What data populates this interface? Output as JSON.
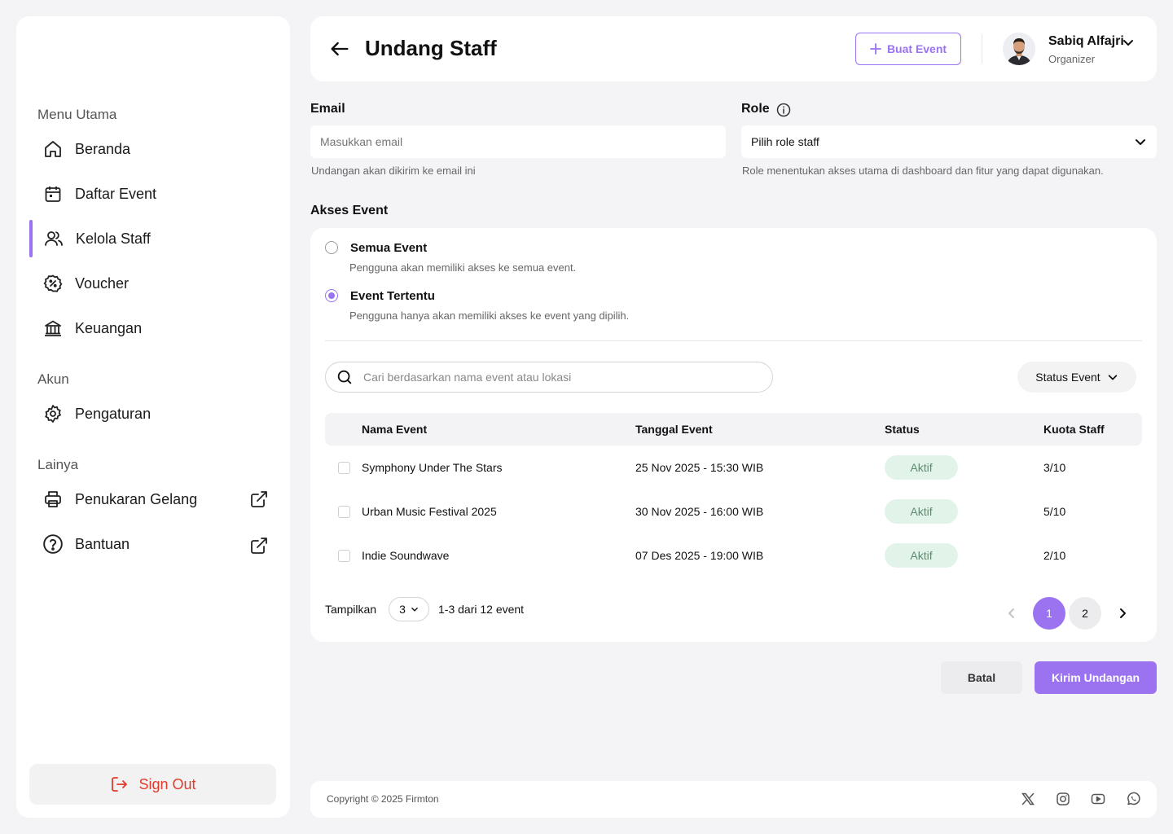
{
  "sidebar": {
    "sections": {
      "main": "Menu Utama",
      "account": "Akun",
      "other": "Lainya"
    },
    "items": [
      {
        "label": "Beranda",
        "icon": "home-icon"
      },
      {
        "label": "Daftar Event",
        "icon": "calendar-icon"
      },
      {
        "label": "Kelola Staff",
        "icon": "users-icon",
        "active": true
      },
      {
        "label": "Voucher",
        "icon": "voucher-icon"
      },
      {
        "label": "Keuangan",
        "icon": "bank-icon"
      },
      {
        "label": "Pengaturan",
        "icon": "gear-icon"
      },
      {
        "label": "Penukaran Gelang",
        "icon": "printer-icon",
        "external": true
      },
      {
        "label": "Bantuan",
        "icon": "help-icon",
        "external": true
      }
    ],
    "signout": "Sign Out"
  },
  "header": {
    "title": "Undang Staff",
    "create_button": "Buat Event",
    "user": {
      "name": "Sabiq Alfajri",
      "role": "Organizer"
    }
  },
  "form": {
    "email": {
      "label": "Email",
      "placeholder": "Masukkan email",
      "help": "Undangan akan dikirim ke email ini"
    },
    "role": {
      "label": "Role",
      "value": "Pilih role staff",
      "help": "Role menentukan akses utama di dashboard dan fitur yang dapat digunakan."
    }
  },
  "access": {
    "title": "Akses Event",
    "options": [
      {
        "label": "Semua Event",
        "desc": "Pengguna akan memiliki akses ke semua event.",
        "selected": false
      },
      {
        "label": "Event Tertentu",
        "desc": "Pengguna hanya akan memiliki akses ke event yang dipilih.",
        "selected": true
      }
    ],
    "search_placeholder": "Cari berdasarkan nama event atau lokasi",
    "status_filter": "Status Event",
    "columns": [
      "Nama Event",
      "Tanggal Event",
      "Status",
      "Kuota Staff"
    ],
    "rows": [
      {
        "name": "Symphony Under The Stars",
        "date": "25 Nov 2025 - 15:30 WIB",
        "status": "Aktif",
        "quota": "3/10"
      },
      {
        "name": "Urban Music Festival 2025",
        "date": "30 Nov 2025 - 16:00 WIB",
        "status": "Aktif",
        "quota": "5/10"
      },
      {
        "name": "Indie Soundwave",
        "date": "07 Des 2025 - 19:00 WIB",
        "status": "Aktif",
        "quota": "2/10"
      }
    ],
    "pagination": {
      "show_label": "Tampilkan",
      "per_page": "3",
      "summary": "1-3 dari 12 event",
      "pages": [
        "1",
        "2"
      ],
      "current": "1"
    }
  },
  "actions": {
    "cancel": "Batal",
    "submit": "Kirim Undangan"
  },
  "footer": {
    "copyright": "Copyright © 2025 Firmton",
    "social": [
      "x-icon",
      "instagram-icon",
      "youtube-icon",
      "whatsapp-icon"
    ]
  },
  "colors": {
    "accent": "#9b72f0",
    "danger": "#e03b2c",
    "badge_bg": "#e2f4e9",
    "badge_text": "#5e8a6f",
    "page_bg": "#f4f4f7"
  }
}
